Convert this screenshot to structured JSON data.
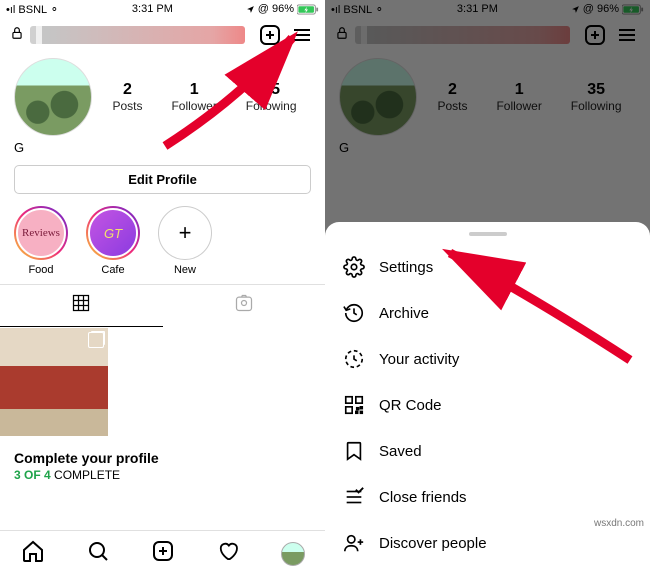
{
  "status": {
    "carrier": "BSNL",
    "time": "3:31 PM",
    "battery_pct": "96%"
  },
  "profile": {
    "name": "G",
    "stats": {
      "posts": {
        "num": "2",
        "label": "Posts"
      },
      "followers": {
        "num": "1",
        "label": "Follower"
      },
      "following": {
        "num": "35",
        "label": "Following"
      }
    },
    "edit_button": "Edit Profile",
    "highlights": [
      {
        "label": "Food",
        "text": "Reviews"
      },
      {
        "label": "Cafe",
        "text": "GT"
      },
      {
        "label": "New",
        "text": "+"
      }
    ],
    "complete": {
      "title": "Complete your profile",
      "done": "3 OF 4",
      "suffix": " COMPLETE"
    }
  },
  "menu": {
    "settings": "Settings",
    "archive": "Archive",
    "activity": "Your activity",
    "qr": "QR Code",
    "saved": "Saved",
    "close_friends": "Close friends",
    "discover": "Discover people"
  },
  "watermark": "wsxdn.com"
}
